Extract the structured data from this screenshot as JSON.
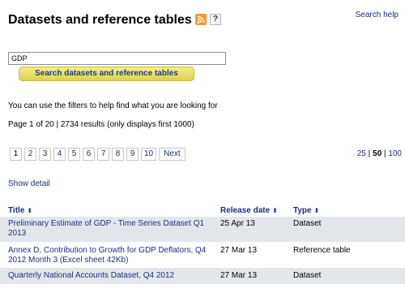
{
  "header": {
    "title": "Datasets and reference tables",
    "help_badge": "?",
    "search_help_link": "Search help"
  },
  "search": {
    "query_value": "GDP",
    "button_label": "Search datasets and reference tables"
  },
  "filters_hint": "You can use the filters to help find what you are looking for",
  "results_summary": "Page 1 of 20 | 2734 results (only displays first 1000)",
  "pagination": {
    "pages": [
      "1",
      "2",
      "3",
      "4",
      "5",
      "6",
      "7",
      "8",
      "9",
      "10"
    ],
    "current_page": "1",
    "next_label": "Next"
  },
  "per_page": {
    "options": [
      "25",
      "50",
      "100"
    ],
    "separator": "|",
    "selected": "50"
  },
  "show_detail_link": "Show detail",
  "table": {
    "columns": {
      "title": "Title",
      "release_date": "Release date",
      "type": "Type"
    },
    "sort_glyph": "⬍",
    "rows": [
      {
        "title": "Preliminary Estimate of GDP - Time Series Dataset Q1 2013",
        "release_date": "25 Apr 13",
        "type": "Dataset"
      },
      {
        "title": "Annex D, Contribution to Growth for GDP Deflators, Q4 2012 Month 3 (Excel sheet 42Kb)",
        "release_date": "27 Mar 13",
        "type": "Reference table"
      },
      {
        "title": "Quarterly National Accounts Dataset, Q4 2012",
        "release_date": "27 Mar 13",
        "type": "Dataset"
      }
    ]
  },
  "icons": {
    "rss": "rss-icon",
    "help": "help-icon",
    "sort": "sort-icon"
  },
  "colors": {
    "link": "#1b2f7c",
    "button_fill": "#e8df64",
    "row_shade": "#e3e7ec",
    "rss": "#f39c2a"
  }
}
